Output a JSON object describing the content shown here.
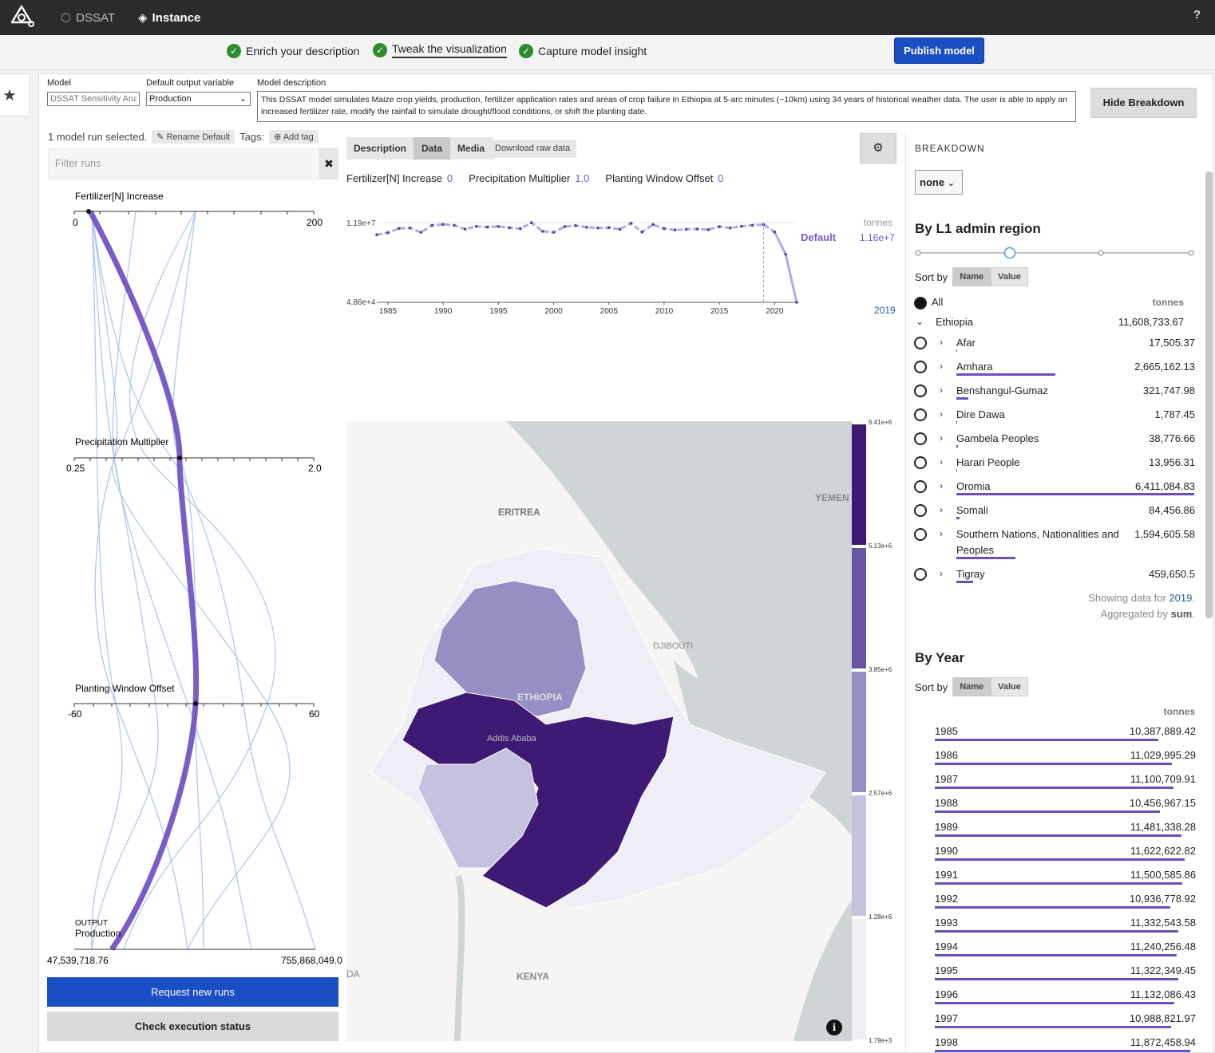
{
  "topbar": {
    "app": "DSSAT",
    "instance": "Instance",
    "help": "?"
  },
  "steps": [
    {
      "label": "Enrich your description",
      "active": false
    },
    {
      "label": "Tweak the visualization",
      "active": true
    },
    {
      "label": "Capture model insight",
      "active": false
    }
  ],
  "publish_label": "Publish model",
  "form": {
    "model_label": "Model",
    "model_placeholder": "DSSAT Sensitivity Analysis",
    "output_label": "Default output variable",
    "output_value": "Production",
    "desc_label": "Model description",
    "description": "This DSSAT model simulates Maize crop yields, production, fertilizer application rates and areas of crop failure in Ethiopia at 5-arc minutes (~10km) using 34 years of historical weather data. The user is able to apply an increased fertilizer rate, modify the rainfall to simulate drought/flood conditions, or shift the planting date.",
    "hide_breakdown": "Hide Breakdown"
  },
  "runs": {
    "selected": "1 model run selected.",
    "rename": "Rename Default",
    "tags": "Tags:",
    "add_tag": "Add tag",
    "filter_placeholder": "Filter runs",
    "clear": "✖"
  },
  "pc": {
    "axes": [
      {
        "name": "Fertilizer[N] Increase",
        "min": "0",
        "max": "200"
      },
      {
        "name": "Precipitation Multiplier",
        "min": "0.25",
        "max": "2.0"
      },
      {
        "name": "Planting Window Offset",
        "min": "-60",
        "max": "60"
      }
    ],
    "output_tag": "OUTPUT",
    "output_name": "Production",
    "output_min": "47,539,718.76",
    "output_max": "755,868,049.0"
  },
  "request_runs": "Request new runs",
  "check_status": "Check execution status",
  "tabs": [
    "Description",
    "Data",
    "Media"
  ],
  "active_tab": "Data",
  "download": "Download raw data",
  "gear": "⚙",
  "params": [
    {
      "name": "Fertilizer[N] Increase",
      "value": "0"
    },
    {
      "name": "Precipitation Multiplier",
      "value": "1.0"
    },
    {
      "name": "Planting Window Offset",
      "value": "0"
    }
  ],
  "chart_data": {
    "type": "line",
    "x": [
      1984,
      1985,
      1986,
      1987,
      1988,
      1989,
      1990,
      1991,
      1992,
      1993,
      1994,
      1995,
      1996,
      1997,
      1998,
      1999,
      2000,
      2001,
      2002,
      2003,
      2004,
      2005,
      2006,
      2007,
      2008,
      2009,
      2010,
      2011,
      2012,
      2013,
      2014,
      2015,
      2016,
      2017,
      2018,
      2019,
      2020,
      2021,
      2022
    ],
    "series": [
      {
        "name": "Default",
        "values": [
          10100000,
          10387889.42,
          11029995.29,
          11100709.91,
          10456967.15,
          11481338.28,
          11622622.82,
          11500585.86,
          10936778.92,
          11332543.58,
          11240256.48,
          11322349.45,
          11132086.43,
          10988821.97,
          11872458.94,
          10600000,
          10450000,
          11300000,
          11450000,
          11200000,
          11100000,
          11150000,
          10900000,
          11800000,
          10500000,
          11600000,
          11000000,
          10800000,
          10900000,
          10950000,
          10850000,
          11300000,
          11100000,
          11350000,
          11500000,
          11608733.67,
          10500000,
          7200000,
          48600
        ]
      }
    ],
    "ylim_labels": [
      "1.19e+7",
      "4.86e+4"
    ],
    "xticks": [
      "1985",
      "1990",
      "1995",
      "2000",
      "2005",
      "2010",
      "2015",
      "2020"
    ],
    "unit": "tonnes",
    "last_value": "1.16e+7",
    "selected_year": "2019",
    "grid": false
  },
  "map": {
    "labels": {
      "eritrea": "ERITREA",
      "yemen": "YEMEN",
      "djibouti": "DJIBOUTI",
      "ethiopia": "ETHIOPIA",
      "addis": "Addis Ababa",
      "kenya": "KENYA",
      "da": "DA"
    },
    "legend": [
      "6.41e+6",
      "5.13e+6",
      "3.85e+6",
      "2.57e+6",
      "1.28e+6",
      "1.79e+3"
    ],
    "colors": [
      "#3f1a74",
      "#6a54a5",
      "#958fc4",
      "#c4c2df",
      "#efedf6"
    ],
    "info": "i"
  },
  "breakdown": {
    "title": "BREAKDOWN",
    "none": "none",
    "region_title": "By L1 admin region",
    "sort_by": "Sort by",
    "sort_name": "Name",
    "sort_value": "Value",
    "all": "All",
    "unit": "tonnes",
    "country": "Ethiopia",
    "country_value": "11,608,733.67",
    "regions": [
      {
        "name": "Afar",
        "value": "17,505.37",
        "frac": 0.003
      },
      {
        "name": "Amhara",
        "value": "2,665,162.13",
        "frac": 0.416
      },
      {
        "name": "Benshangul-Gumaz",
        "value": "321,747.98",
        "frac": 0.05
      },
      {
        "name": "Dire Dawa",
        "value": "1,787.45",
        "frac": 0.001
      },
      {
        "name": "Gambela Peoples",
        "value": "38,776.66",
        "frac": 0.006
      },
      {
        "name": "Harari People",
        "value": "13,956.31",
        "frac": 0.002
      },
      {
        "name": "Oromia",
        "value": "6,411,084.83",
        "frac": 1.0
      },
      {
        "name": "Somali",
        "value": "84,456.86",
        "frac": 0.013
      },
      {
        "name": "Southern Nations, Nationalities and Peoples",
        "value": "1,594,605.58",
        "frac": 0.249
      },
      {
        "name": "Tigray",
        "value": "459,650.5",
        "frac": 0.072
      }
    ],
    "showing": "Showing data for ",
    "showing_year": "2019",
    "aggregated": "Aggregated by ",
    "aggregated_fn": "sum",
    "year_title": "By Year",
    "years": [
      {
        "year": "1985",
        "value": "10,387,889.42",
        "frac": 0.874
      },
      {
        "year": "1986",
        "value": "11,029,995.29",
        "frac": 0.929
      },
      {
        "year": "1987",
        "value": "11,100,709.91",
        "frac": 0.935
      },
      {
        "year": "1988",
        "value": "10,456,967.15",
        "frac": 0.881
      },
      {
        "year": "1989",
        "value": "11,481,338.28",
        "frac": 0.967
      },
      {
        "year": "1990",
        "value": "11,622,622.82",
        "frac": 0.979
      },
      {
        "year": "1991",
        "value": "11,500,585.86",
        "frac": 0.968
      },
      {
        "year": "1992",
        "value": "10,936,778.92",
        "frac": 0.921
      },
      {
        "year": "1993",
        "value": "11,332,543.58",
        "frac": 0.954
      },
      {
        "year": "1994",
        "value": "11,240,256.48",
        "frac": 0.947
      },
      {
        "year": "1995",
        "value": "11,322,349.45",
        "frac": 0.954
      },
      {
        "year": "1996",
        "value": "11,132,086.43",
        "frac": 0.937
      },
      {
        "year": "1997",
        "value": "10,988,821.97",
        "frac": 0.925
      },
      {
        "year": "1998",
        "value": "11,872,458.94",
        "frac": 1.0
      }
    ]
  }
}
